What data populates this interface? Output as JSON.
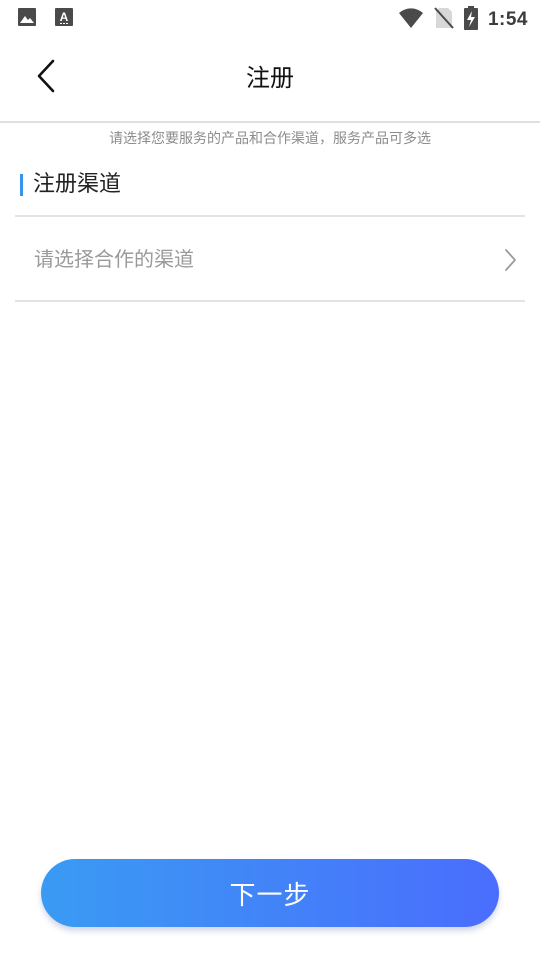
{
  "status_bar": {
    "time": "1:54",
    "left_icons": [
      "image-icon",
      "text-a-icon"
    ],
    "right_icons": [
      "wifi-icon",
      "no-sim-icon",
      "battery-charging-icon"
    ]
  },
  "header": {
    "title": "注册",
    "back_icon": "chevron-left-icon"
  },
  "hint": "请选择您要服务的产品和合作渠道，服务产品可多选",
  "section": {
    "title": "注册渠道",
    "accent_color": "#3a93e9"
  },
  "channel_select": {
    "placeholder": "请选择合作的渠道",
    "icon": "chevron-right-icon"
  },
  "footer": {
    "next_label": "下一步",
    "gradient_start": "#3a9bf3",
    "gradient_end": "#4a6dfd"
  }
}
